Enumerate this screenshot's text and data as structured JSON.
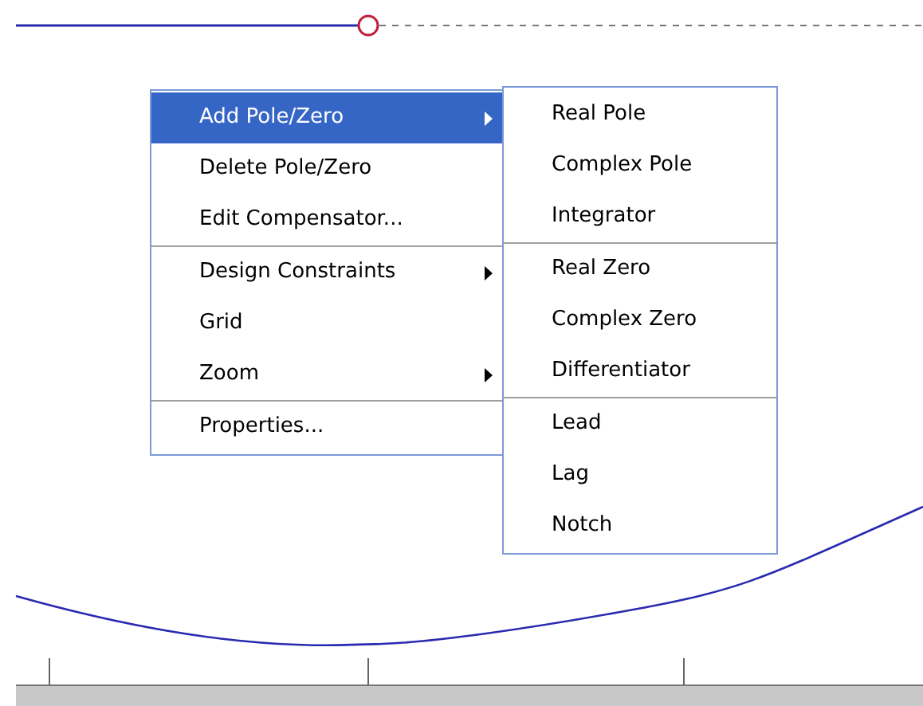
{
  "context_menu": {
    "sections": [
      [
        {
          "label": "Add Pole/Zero",
          "selected": true,
          "has_submenu": true
        },
        {
          "label": "Delete Pole/Zero",
          "selected": false,
          "has_submenu": false
        },
        {
          "label": "Edit Compensator...",
          "selected": false,
          "has_submenu": false
        }
      ],
      [
        {
          "label": "Design Constraints",
          "selected": false,
          "has_submenu": true
        },
        {
          "label": "Grid",
          "selected": false,
          "has_submenu": false
        },
        {
          "label": "Zoom",
          "selected": false,
          "has_submenu": true
        }
      ],
      [
        {
          "label": "Properties...",
          "selected": false,
          "has_submenu": false
        }
      ]
    ]
  },
  "submenu": {
    "sections": [
      [
        {
          "label": "Real Pole"
        },
        {
          "label": "Complex Pole"
        },
        {
          "label": "Integrator"
        }
      ],
      [
        {
          "label": "Real Zero"
        },
        {
          "label": "Complex Zero"
        },
        {
          "label": "Differentiator"
        }
      ],
      [
        {
          "label": "Lead"
        },
        {
          "label": "Lag"
        },
        {
          "label": "Notch"
        }
      ]
    ]
  }
}
